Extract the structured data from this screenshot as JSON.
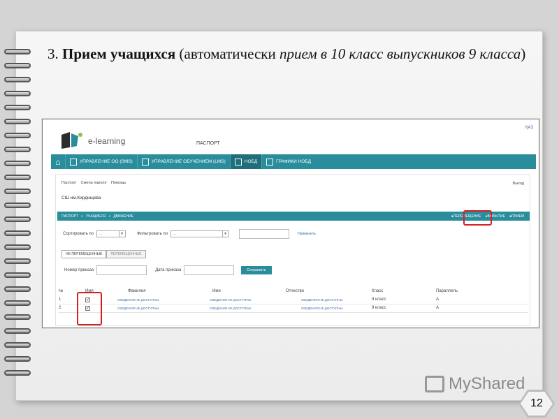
{
  "slide": {
    "title_number": "3.",
    "title_bold": "Прием учащихся",
    "title_paren_open": "(автоматически ",
    "title_italic": "прием в 10 класс выпускников 9 класса",
    "title_paren_close": ")",
    "page_number": "12",
    "watermark": "MyShared"
  },
  "app": {
    "logo_text": "e-learning",
    "lang": "ҚАЗ",
    "header_title": "ПАСПОРТ",
    "nav": [
      {
        "label": "УПРАВЛЕНИЕ ОО (SMS)"
      },
      {
        "label": "УПРАВЛЕНИЕ ОБУЧЕНИЕМ (LMS)"
      },
      {
        "label": "НОБД"
      },
      {
        "label": "ГРАФИКИ НОБД"
      }
    ],
    "toplinks": [
      "Паспорт",
      "Смена пароля",
      "Помощь"
    ],
    "exit": "Выход",
    "school": "СШ им.Кирдищева",
    "breadcrumb": [
      "ПАСПОРТ",
      "»",
      "УЧАЩИЕСЯ",
      "»",
      "ДВИЖЕНИЕ"
    ],
    "actions": [
      "ПЕРЕМЕЩЕНИЕ",
      "ВЫБЫТИЕ",
      "ПРИЕМ"
    ],
    "sort_label": "Сортировать по",
    "sort_value": "...",
    "filter_label": "Фильтровать по",
    "filter_value": "...",
    "apply": "Применить",
    "tabs": [
      "НЕ ПЕРЕМЕЩЕННЫЕ",
      "ПЕРЕМЕЩЕННЫЕ"
    ],
    "order_number_label": "Номер приказа",
    "order_date_label": "Дата приказа",
    "save": "Сохранить",
    "table": {
      "headers": [
        "№",
        "Имя",
        "Фамилия",
        "Имя",
        "Отчество",
        "Класс",
        "Параллель"
      ],
      "rows": [
        {
          "n": "1",
          "checked": "✓",
          "last": "СВЕДЕНИЯ НЕ ДОСТУПНЫ",
          "first": "СВЕДЕНИЯ НЕ ДОСТУПНЫ",
          "middle": "СВЕДЕНИЯ НЕ ДОСТУПНЫ",
          "class": "9 класс",
          "parallel": "А"
        },
        {
          "n": "2",
          "checked": "✓",
          "last": "СВЕДЕНИЯ НЕ ДОСТУПНЫ",
          "first": "СВЕДЕНИЯ НЕ ДОСТУПНЫ",
          "middle": "СВЕДЕНИЯ НЕ ДОСТУПНЫ",
          "class": "9 класс",
          "parallel": "А"
        }
      ]
    }
  },
  "colors": {
    "accent": "#2a8d9c",
    "highlight": "#d62020"
  }
}
